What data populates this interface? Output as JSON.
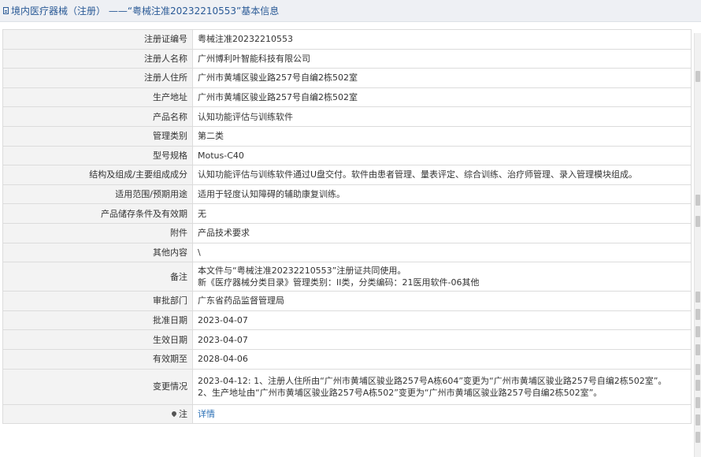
{
  "header": {
    "title": "境内医疗器械（注册） ——“粤械注准20232210553”基本信息"
  },
  "rows": [
    {
      "label": "注册证编号",
      "value": "粤械注准20232210553"
    },
    {
      "label": "注册人名称",
      "value": "广州博利叶智能科技有限公司"
    },
    {
      "label": "注册人住所",
      "value": "广州市黄埔区骏业路257号自编2栋502室"
    },
    {
      "label": "生产地址",
      "value": "广州市黄埔区骏业路257号自编2栋502室"
    },
    {
      "label": "产品名称",
      "value": "认知功能评估与训练软件"
    },
    {
      "label": "管理类别",
      "value": "第二类"
    },
    {
      "label": "型号规格",
      "value": "Motus-C40"
    },
    {
      "label": "结构及组成/主要组成成分",
      "value": "认知功能评估与训练软件通过U盘交付。软件由患者管理、量表评定、综合训练、治疗师管理、录入管理模块组成。"
    },
    {
      "label": "适用范围/预期用途",
      "value": "适用于轻度认知障碍的辅助康复训练。"
    },
    {
      "label": "产品储存条件及有效期",
      "value": "无"
    },
    {
      "label": "附件",
      "value": "产品技术要求"
    },
    {
      "label": "其他内容",
      "value": "\\"
    }
  ],
  "remark": {
    "label": "备注",
    "line1": "本文件与“粤械注准20232210553”注册证共同使用。",
    "line2": "新《医疗器械分类目录》管理类别：II类，分类编码：21医用软件-06其他"
  },
  "rows2": [
    {
      "label": "审批部门",
      "value": "广东省药品监督管理局"
    },
    {
      "label": "批准日期",
      "value": "2023-04-07"
    },
    {
      "label": "生效日期",
      "value": "2023-04-07"
    },
    {
      "label": "有效期至",
      "value": "2028-04-06"
    }
  ],
  "change": {
    "label": "变更情况",
    "line1": "2023-04-12: 1、注册人住所由“广州市黄埔区骏业路257号A栋604”变更为“广州市黄埔区骏业路257号自编2栋502室”。",
    "line2": "2、生产地址由“广州市黄埔区骏业路257号A栋502”变更为“广州市黄埔区骏业路257号自编2栋502室”。"
  },
  "note": {
    "label": "注",
    "link": "详情",
    "icon": "pin-icon"
  }
}
